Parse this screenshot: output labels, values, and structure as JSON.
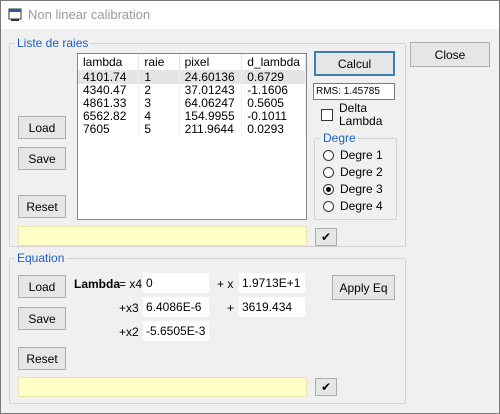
{
  "window": {
    "title": "Non linear calibration"
  },
  "liste": {
    "legend": "Liste de raies",
    "columns": [
      "lambda",
      "raie",
      "pixel",
      "d_lambda"
    ],
    "rows": [
      [
        "4101.74",
        "1",
        "24.60136",
        "0.6729"
      ],
      [
        "4340.47",
        "2",
        "37.01243",
        "-1.1606"
      ],
      [
        "4861.33",
        "3",
        "64.06247",
        "0.5605"
      ],
      [
        "6562.82",
        "4",
        "154.9955",
        "-0.1011"
      ],
      [
        "7605",
        "5",
        "211.9644",
        "0.0293"
      ]
    ],
    "load_label": "Load",
    "save_label": "Save",
    "reset_label": "Reset",
    "calcul_label": "Calcul",
    "rms_text": "RMS:  1.45785",
    "delta_lambda_label": "Delta\nLambda",
    "degre_legend": "Degre",
    "degre_options": [
      "Degre 1",
      "Degre 2",
      "Degre 3",
      "Degre 4"
    ],
    "degre_selected": 2,
    "check_label": "✔"
  },
  "close_label": "Close",
  "equation": {
    "legend": "Equation",
    "load_label": "Load",
    "save_label": "Save",
    "reset_label": "Reset",
    "lambda_label": "Lambda",
    "x4_label": "= x4",
    "x4_value": "0",
    "x_label": "+ x",
    "x_value": "1.9713E+1",
    "x3_label": "+x3",
    "x3_value": "6.4086E-6",
    "plus_label": "+",
    "const_value": "3619.434",
    "x2_label": "+x2",
    "x2_value": "-5.6505E-3",
    "apply_label": "Apply Eq",
    "check_label": "✔"
  },
  "colors": {
    "accent": "#1f5fbf",
    "selected_row": "#e5e5e5",
    "yellow_field": "#ffffc6"
  }
}
